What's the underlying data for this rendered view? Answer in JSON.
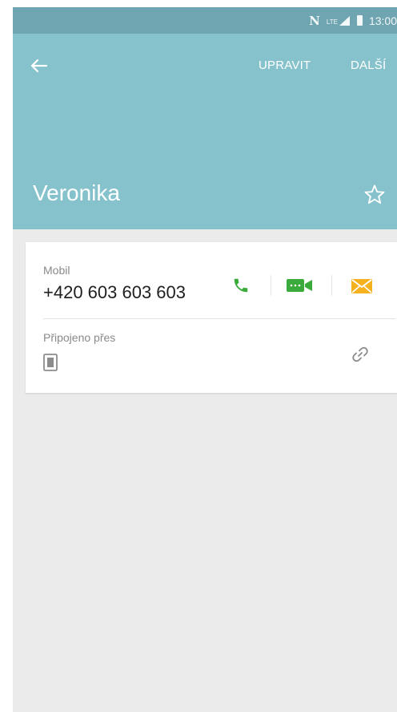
{
  "status_bar": {
    "time": "13:00",
    "network": "LTE",
    "icons": [
      "nfc-icon",
      "lte-signal-icon",
      "battery-icon"
    ]
  },
  "toolbar": {
    "back_icon": "arrow-left-icon",
    "edit_label": "UPRAVIT",
    "more_label": "DALŠÍ"
  },
  "contact": {
    "name": "Veronika",
    "favorite_icon": "star-outline-icon"
  },
  "phone": {
    "type_label": "Mobil",
    "number": "+420 603 603 603",
    "actions": [
      {
        "name": "call",
        "icon": "phone-icon",
        "color": "#3aab3a"
      },
      {
        "name": "video-call",
        "icon": "video-icon",
        "color": "#3aab3a"
      },
      {
        "name": "message",
        "icon": "envelope-icon",
        "color": "#f5b11e"
      }
    ]
  },
  "linked": {
    "label": "Připojeno přes",
    "source_icon": "device-storage-icon",
    "link_icon": "link-icon"
  },
  "colors": {
    "status_bar": "#6ea5b0",
    "header": "#86c2cc",
    "background": "#ebebeb",
    "card": "#ffffff",
    "call_green": "#3aab3a",
    "message_orange": "#f5b11e"
  }
}
